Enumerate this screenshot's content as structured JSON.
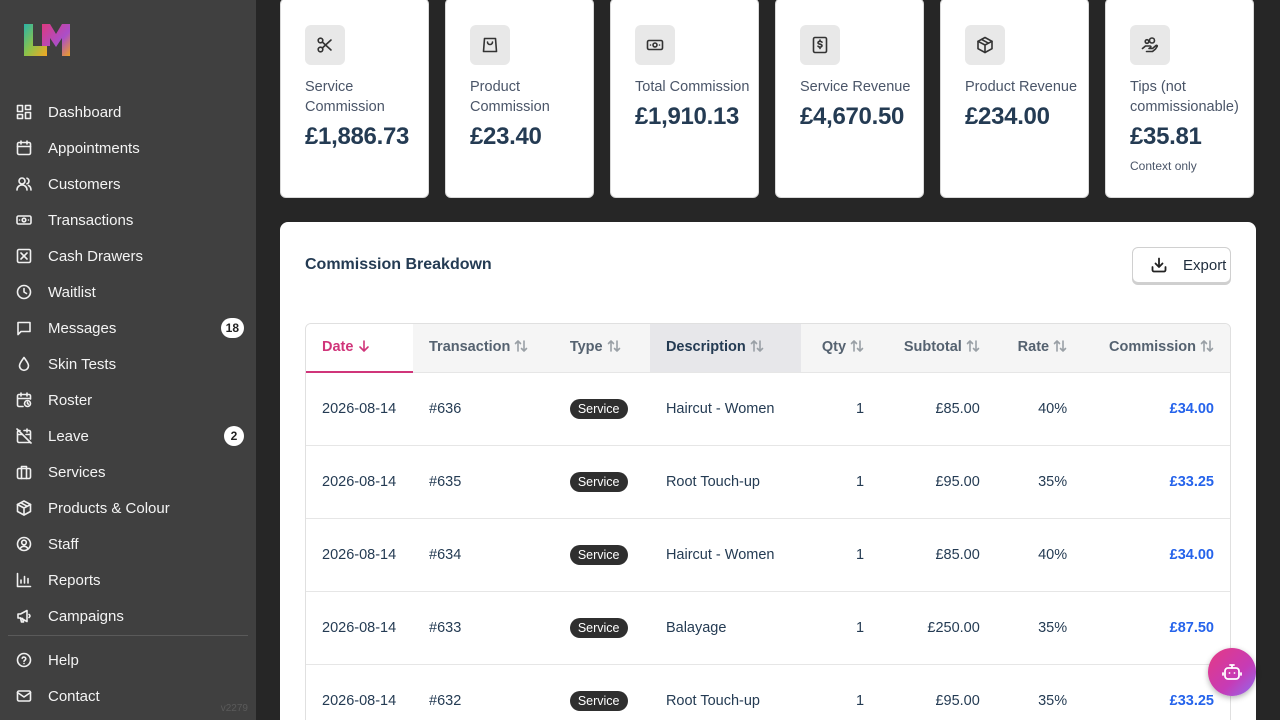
{
  "sidebar": {
    "items": [
      {
        "label": "Dashboard",
        "icon": "grid-icon"
      },
      {
        "label": "Appointments",
        "icon": "calendar-icon"
      },
      {
        "label": "Customers",
        "icon": "users-icon"
      },
      {
        "label": "Transactions",
        "icon": "banknote-icon"
      },
      {
        "label": "Cash Drawers",
        "icon": "box-x-icon"
      },
      {
        "label": "Waitlist",
        "icon": "clock-icon"
      },
      {
        "label": "Messages",
        "icon": "message-icon",
        "badge": "18"
      },
      {
        "label": "Skin Tests",
        "icon": "droplet-icon"
      },
      {
        "label": "Roster",
        "icon": "calendar-clock-icon"
      },
      {
        "label": "Leave",
        "icon": "calendar-off-icon",
        "badge": "2"
      },
      {
        "label": "Services",
        "icon": "briefcase-icon"
      },
      {
        "label": "Products & Colour",
        "icon": "package-icon"
      },
      {
        "label": "Staff",
        "icon": "user-circle-icon"
      },
      {
        "label": "Reports",
        "icon": "bar-chart-icon"
      },
      {
        "label": "Campaigns",
        "icon": "megaphone-icon"
      }
    ],
    "bottom": [
      {
        "label": "Help",
        "icon": "help-circle-icon"
      },
      {
        "label": "Contact",
        "icon": "mail-icon"
      }
    ],
    "version": "v2279"
  },
  "cards": [
    {
      "label": "Service Commission",
      "value": "£1,886.73",
      "icon": "scissors-icon",
      "note": ""
    },
    {
      "label": "Product Commission",
      "value": "£23.40",
      "icon": "shopping-bag-icon",
      "note": ""
    },
    {
      "label": "Total Commission",
      "value": "£1,910.13",
      "icon": "banknote-icon",
      "note": ""
    },
    {
      "label": "Service Revenue",
      "value": "£4,670.50",
      "icon": "receipt-dollar-icon",
      "note": ""
    },
    {
      "label": "Product Revenue",
      "value": "£234.00",
      "icon": "package-icon",
      "note": ""
    },
    {
      "label": "Tips (not commissionable)",
      "value": "£35.81",
      "icon": "hand-coins-icon",
      "note": "Context only"
    }
  ],
  "breakdown": {
    "title": "Commission Breakdown",
    "export_label": "Export",
    "columns": [
      "Date",
      "Transaction",
      "Type",
      "Description",
      "Qty",
      "Subtotal",
      "Rate",
      "Commission"
    ],
    "rows": [
      {
        "date": "2026-08-14",
        "transaction": "#636",
        "type": "Service",
        "description": "Haircut - Women",
        "qty": "1",
        "subtotal": "£85.00",
        "rate": "40%",
        "commission": "£34.00"
      },
      {
        "date": "2026-08-14",
        "transaction": "#635",
        "type": "Service",
        "description": "Root Touch-up",
        "qty": "1",
        "subtotal": "£95.00",
        "rate": "35%",
        "commission": "£33.25"
      },
      {
        "date": "2026-08-14",
        "transaction": "#634",
        "type": "Service",
        "description": "Haircut - Women",
        "qty": "1",
        "subtotal": "£85.00",
        "rate": "40%",
        "commission": "£34.00"
      },
      {
        "date": "2026-08-14",
        "transaction": "#633",
        "type": "Service",
        "description": "Balayage",
        "qty": "1",
        "subtotal": "£250.00",
        "rate": "35%",
        "commission": "£87.50"
      },
      {
        "date": "2026-08-14",
        "transaction": "#632",
        "type": "Service",
        "description": "Root Touch-up",
        "qty": "1",
        "subtotal": "£95.00",
        "rate": "35%",
        "commission": "£33.25"
      }
    ]
  },
  "colors": {
    "accent": "#d0357a",
    "commission": "#2563eb",
    "sidebar": "#404040",
    "background": "#262626"
  }
}
